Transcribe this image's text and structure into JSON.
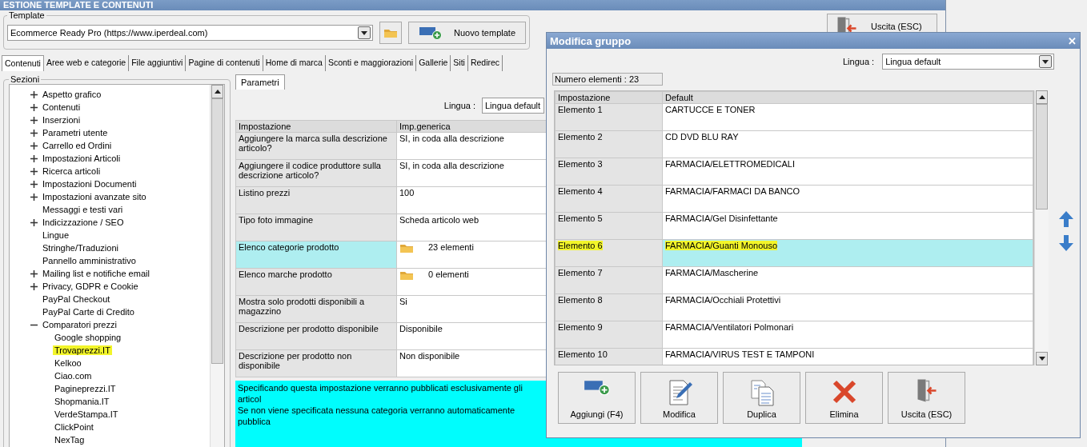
{
  "window": {
    "title": "ESTIONE TEMPLATE E CONTENUTI"
  },
  "template": {
    "legend": "Template",
    "value": "Ecommerce Ready Pro (https://www.iperdeal.com)",
    "new_button": "Nuovo template",
    "exit_button": "Uscita (ESC)"
  },
  "tabs": [
    {
      "label": "Contenuti",
      "selected": true
    },
    {
      "label": "Aree web e categorie",
      "selected": false
    },
    {
      "label": "File aggiuntivi",
      "selected": false
    },
    {
      "label": "Pagine di contenuti",
      "selected": false
    },
    {
      "label": "Home di marca",
      "selected": false
    },
    {
      "label": "Sconti e maggiorazioni",
      "selected": false
    },
    {
      "label": "Gallerie",
      "selected": false
    },
    {
      "label": "Siti",
      "selected": false
    },
    {
      "label": "Redirec",
      "selected": false
    }
  ],
  "sections": {
    "legend": "Sezioni",
    "items": [
      {
        "label": "Aspetto grafico",
        "expanded": false,
        "highlighted": false
      },
      {
        "label": "Contenuti",
        "expanded": false,
        "highlighted": false
      },
      {
        "label": "Inserzioni",
        "expanded": false,
        "highlighted": false
      },
      {
        "label": "Parametri utente",
        "expanded": false,
        "highlighted": false
      },
      {
        "label": "Carrello ed Ordini",
        "expanded": false,
        "highlighted": false
      },
      {
        "label": "Impostazioni Articoli",
        "expanded": false,
        "highlighted": false
      },
      {
        "label": "Ricerca articoli",
        "expanded": false,
        "highlighted": false
      },
      {
        "label": "Impostazioni Documenti",
        "expanded": false,
        "highlighted": false
      },
      {
        "label": "Impostazioni avanzate sito",
        "expanded": false,
        "highlighted": false
      },
      {
        "label": "Messaggi e testi vari",
        "highlighted": false
      },
      {
        "label": "Indicizzazione / SEO",
        "expanded": false,
        "highlighted": false
      },
      {
        "label": "Lingue",
        "highlighted": false
      },
      {
        "label": "Stringhe/Traduzioni",
        "highlighted": false
      },
      {
        "label": "Pannello amministrativo",
        "highlighted": false
      },
      {
        "label": "Mailing list e notifiche email",
        "expanded": false,
        "highlighted": false
      },
      {
        "label": "Privacy, GDPR e Cookie",
        "expanded": false,
        "highlighted": false
      },
      {
        "label": "PayPal Checkout",
        "highlighted": false
      },
      {
        "label": "PayPal Carte di Credito",
        "highlighted": false
      },
      {
        "label": "Comparatori prezzi",
        "expanded": true,
        "highlighted": false,
        "children": [
          {
            "label": "Google shopping",
            "highlighted": false
          },
          {
            "label": "Trovaprezzi.IT",
            "highlighted": true
          },
          {
            "label": "Kelkoo",
            "highlighted": false
          },
          {
            "label": "Ciao.com",
            "highlighted": false
          },
          {
            "label": "Pagineprezzi.IT",
            "highlighted": false
          },
          {
            "label": "Shopmania.IT",
            "highlighted": false
          },
          {
            "label": "VerdeStampa.IT",
            "highlighted": false
          },
          {
            "label": "ClickPoint",
            "highlighted": false
          },
          {
            "label": "NexTag",
            "highlighted": false
          }
        ]
      }
    ]
  },
  "params": {
    "tab": "Parametri",
    "language_label": "Lingua :",
    "language": "Lingua default",
    "columns": [
      "Impostazione",
      "Imp.generica"
    ],
    "rows": [
      {
        "setting": "Aggiungere la marca sulla descrizione articolo?",
        "value": "SI, in coda alla descrizione",
        "kind": "text",
        "selected": false
      },
      {
        "setting": "Aggiungere il codice produttore sulla descrizione articolo?",
        "value": "SI, in coda alla descrizione",
        "kind": "text",
        "selected": false
      },
      {
        "setting": "Listino prezzi",
        "value": "100",
        "kind": "text",
        "selected": false
      },
      {
        "setting": "Tipo foto immagine",
        "value": "Scheda articolo web",
        "kind": "text",
        "selected": false
      },
      {
        "setting": "Elenco categorie prodotto",
        "value": "23 elementi",
        "kind": "list",
        "selected": true
      },
      {
        "setting": "Elenco marche prodotto",
        "value": "0 elementi",
        "kind": "list",
        "selected": false
      },
      {
        "setting": "Mostra solo prodotti disponibili a magazzino",
        "value": "Si",
        "kind": "text",
        "selected": false
      },
      {
        "setting": "Descrizione per prodotto disponibile",
        "value": "Disponibile",
        "kind": "text",
        "selected": false
      },
      {
        "setting": "Descrizione per prodotto non disponibile",
        "value": "Non disponibile",
        "kind": "text",
        "selected": false
      }
    ],
    "description": [
      "Specificando questa impostazione verranno pubblicati esclusivamente gli articol",
      "Se non viene specificata nessuna categoria verranno automaticamente pubblica"
    ]
  },
  "dialog": {
    "title": "Modifica gruppo",
    "close": "✕",
    "language_label": "Lingua :",
    "language": "Lingua default",
    "count": "Numero elementi : 23",
    "columns": [
      "Impostazione",
      "Default"
    ],
    "rows": [
      {
        "name": "Elemento 1",
        "value": "CARTUCCE E TONER",
        "selected": false,
        "highlighted": false
      },
      {
        "name": "Elemento 2",
        "value": "CD DVD BLU RAY",
        "selected": false,
        "highlighted": false
      },
      {
        "name": "Elemento 3",
        "value": "FARMACIA/ELETTROMEDICALI",
        "selected": false,
        "highlighted": false
      },
      {
        "name": "Elemento 4",
        "value": "FARMACIA/FARMACI DA BANCO",
        "selected": false,
        "highlighted": false
      },
      {
        "name": "Elemento 5",
        "value": "FARMACIA/Gel Disinfettante",
        "selected": false,
        "highlighted": false
      },
      {
        "name": "Elemento 6",
        "value": "FARMACIA/Guanti Monouso",
        "selected": true,
        "highlighted": true
      },
      {
        "name": "Elemento 7",
        "value": "FARMACIA/Mascherine",
        "selected": false,
        "highlighted": false
      },
      {
        "name": "Elemento 8",
        "value": "FARMACIA/Occhiali Protettivi",
        "selected": false,
        "highlighted": false
      },
      {
        "name": "Elemento 9",
        "value": "FARMACIA/Ventilatori Polmonari",
        "selected": false,
        "highlighted": false
      },
      {
        "name": "Elemento 10",
        "value": "FARMACIA/VIRUS TEST E TAMPONI",
        "selected": false,
        "highlighted": false
      }
    ],
    "buttons": [
      {
        "label": "Aggiungi (F4)",
        "kind": "add"
      },
      {
        "label": "Modifica",
        "kind": "edit"
      },
      {
        "label": "Duplica",
        "kind": "duplicate"
      },
      {
        "label": "Elimina",
        "kind": "delete"
      },
      {
        "label": "Uscita (ESC)",
        "kind": "exit"
      }
    ]
  }
}
